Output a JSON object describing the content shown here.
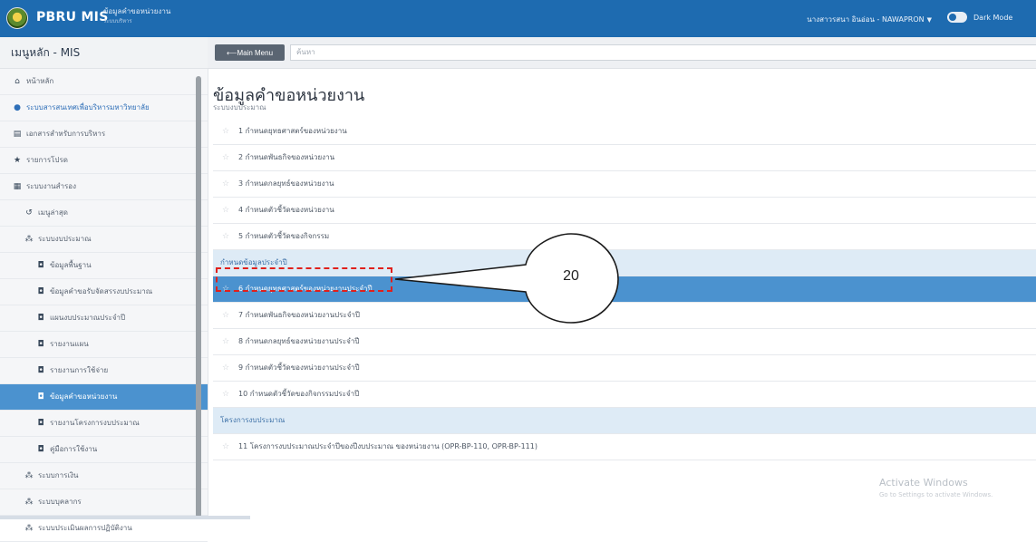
{
  "topbar": {
    "app_name": "PBRU MIS",
    "subtitle_line1": "ข้อมูลคำขอหน่วยงาน",
    "subtitle_line2": "ระบบบริหาร",
    "user_label": "นางสาวรสนา อินอ่อน - NAWAPRON",
    "dark_mode_label": "Dark Mode"
  },
  "sidebar": {
    "header": "เมนูหลัก - MIS",
    "items": [
      {
        "label": "หน้าหลัก",
        "icon": "home-icon",
        "glyph": "⌂"
      },
      {
        "label": "ระบบสารสนเทศเพื่อบริหารมหาวิทยาลัย",
        "icon": "circle-icon",
        "glyph": "●"
      },
      {
        "label": "เอกสารสำหรับการบริหาร",
        "icon": "document-icon",
        "glyph": "▤"
      },
      {
        "label": "รายการโปรด",
        "icon": "star-icon",
        "glyph": "★"
      },
      {
        "label": "ระบบงานสำรอง",
        "icon": "grid-icon",
        "glyph": "▦"
      },
      {
        "label": "เมนูล่าสุด",
        "icon": "history-icon",
        "glyph": "↺"
      },
      {
        "label": "ระบบงบประมาณ",
        "icon": "cluster-icon",
        "glyph": "⁂"
      },
      {
        "label": "ข้อมูลพื้นฐาน",
        "icon": "item-icon",
        "glyph": "◘"
      },
      {
        "label": "ข้อมูลคำขอรับจัดสรรงบประมาณ",
        "icon": "item-icon",
        "glyph": "◘"
      },
      {
        "label": "แผนงบประมาณประจำปี",
        "icon": "item-icon",
        "glyph": "◘"
      },
      {
        "label": "รายงานแผน",
        "icon": "item-icon",
        "glyph": "◘"
      },
      {
        "label": "รายงานการใช้จ่าย",
        "icon": "item-icon",
        "glyph": "◘"
      },
      {
        "label": "ข้อมูลคำขอหน่วยงาน",
        "icon": "item-icon",
        "glyph": "◘"
      },
      {
        "label": "รายงานโครงการงบประมาณ",
        "icon": "item-icon",
        "glyph": "◘"
      },
      {
        "label": "คู่มือการใช้งาน",
        "icon": "item-icon",
        "glyph": "◘"
      },
      {
        "label": "ระบบการเงิน",
        "icon": "cluster-icon",
        "glyph": "⁂"
      },
      {
        "label": "ระบบบุคลากร",
        "icon": "cluster-icon",
        "glyph": "⁂"
      },
      {
        "label": "ระบบประเมินผลการปฏิบัติงาน",
        "icon": "cluster-icon",
        "glyph": "⁂"
      }
    ]
  },
  "toolbar": {
    "main_menu_label": "⟵Main Menu",
    "search_placeholder": "ค้นหา"
  },
  "content": {
    "title": "ข้อมูลคำขอหน่วยงาน",
    "section_label": "ระบบงบประมาณ",
    "rows": [
      {
        "text": "1  กำหนดยุทธศาสตร์ของหน่วยงาน"
      },
      {
        "text": "2  กำหนดพันธกิจของหน่วยงาน"
      },
      {
        "text": "3  กำหนดกลยุทธ์ของหน่วยงาน"
      },
      {
        "text": "4  กำหนดตัวชี้วัดของหน่วยงาน"
      },
      {
        "text": "5  กำหนดตัวชี้วัดของกิจกรรม"
      },
      {
        "group": "กำหนดข้อมูลประจำปี"
      },
      {
        "text": "6  กำหนดยุทธศาสตร์ของหน่วยงานประจำปี",
        "selected": true
      },
      {
        "text": "7  กำหนดพันธกิจของหน่วยงานประจำปี"
      },
      {
        "text": "8  กำหนดกลยุทธ์ของหน่วยงานประจำปี"
      },
      {
        "text": "9  กำหนดตัวชี้วัดของหน่วยงานประจำปี"
      },
      {
        "text": "10  กำหนดตัวชี้วัดของกิจกรรมประจำปี"
      },
      {
        "group": "โครงการงบประมาณ"
      },
      {
        "text": "11  โครงการงบประมาณประจำปีของปีงบประมาณ ของหน่วยงาน (OPR-BP-110, OPR-BP-111)"
      }
    ]
  },
  "annotation": {
    "callout_number": "20"
  },
  "watermark": {
    "line1": "Activate Windows",
    "line2": "Go to Settings to activate Windows."
  },
  "colors": {
    "topbar": "#1e6bb0",
    "active": "#4b92cf",
    "group_bg": "#deebf6",
    "highlight_border": "#e0201c"
  }
}
